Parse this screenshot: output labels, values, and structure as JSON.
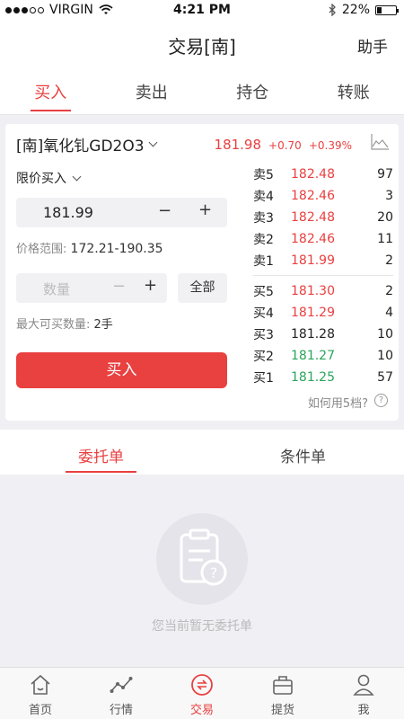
{
  "status_bar": {
    "carrier": "VIRGIN",
    "time": "4:21 PM",
    "battery": "22%"
  },
  "nav": {
    "title": "交易[南]",
    "help": "助手"
  },
  "tabs": [
    {
      "label": "买入",
      "active": true
    },
    {
      "label": "卖出",
      "active": false
    },
    {
      "label": "持仓",
      "active": false
    },
    {
      "label": "转账",
      "active": false
    }
  ],
  "product": {
    "name": "[南]氧化钆GD2O3",
    "price": "181.98",
    "change": "+0.70",
    "change_pct": "+0.39%"
  },
  "order_form": {
    "order_type": "限价买入",
    "price": "181.99",
    "range_label": "价格范围:",
    "range_value": "172.21-190.35",
    "qty_placeholder": "数量",
    "all_label": "全部",
    "max_label": "最大可买数量:",
    "max_value": "2手",
    "buy_label": "买入"
  },
  "order_book": {
    "asks": [
      {
        "label": "卖5",
        "price": "182.48",
        "qty": "97",
        "color": "#e94040"
      },
      {
        "label": "卖4",
        "price": "182.46",
        "qty": "3",
        "color": "#e94040"
      },
      {
        "label": "卖3",
        "price": "182.48",
        "qty": "20",
        "color": "#e94040"
      },
      {
        "label": "卖2",
        "price": "182.46",
        "qty": "11",
        "color": "#e94040"
      },
      {
        "label": "卖1",
        "price": "181.99",
        "qty": "2",
        "color": "#e94040"
      }
    ],
    "bids": [
      {
        "label": "买5",
        "price": "181.30",
        "qty": "2",
        "color": "#e94040"
      },
      {
        "label": "买4",
        "price": "181.29",
        "qty": "4",
        "color": "#e94040"
      },
      {
        "label": "买3",
        "price": "181.28",
        "qty": "10",
        "color": "#222222"
      },
      {
        "label": "买2",
        "price": "181.27",
        "qty": "10",
        "color": "#2aa55b"
      },
      {
        "label": "买1",
        "price": "181.25",
        "qty": "57",
        "color": "#2aa55b"
      }
    ],
    "help_text": "如何用5档?",
    "help_mark": "?"
  },
  "sub_tabs": [
    {
      "label": "委托单",
      "active": true
    },
    {
      "label": "条件单",
      "active": false
    }
  ],
  "empty_state": {
    "text": "您当前暂无委托单",
    "icon": "clipboard-question-icon"
  },
  "tab_bar": [
    {
      "label": "首页",
      "icon": "home-icon",
      "active": false
    },
    {
      "label": "行情",
      "icon": "market-trend-icon",
      "active": false
    },
    {
      "label": "交易",
      "icon": "trade-icon",
      "active": true
    },
    {
      "label": "提货",
      "icon": "briefcase-icon",
      "active": false
    },
    {
      "label": "我",
      "icon": "user-icon",
      "active": false
    }
  ],
  "colors": {
    "accent": "#e94040",
    "up": "#e94040",
    "down": "#2aa55b"
  }
}
